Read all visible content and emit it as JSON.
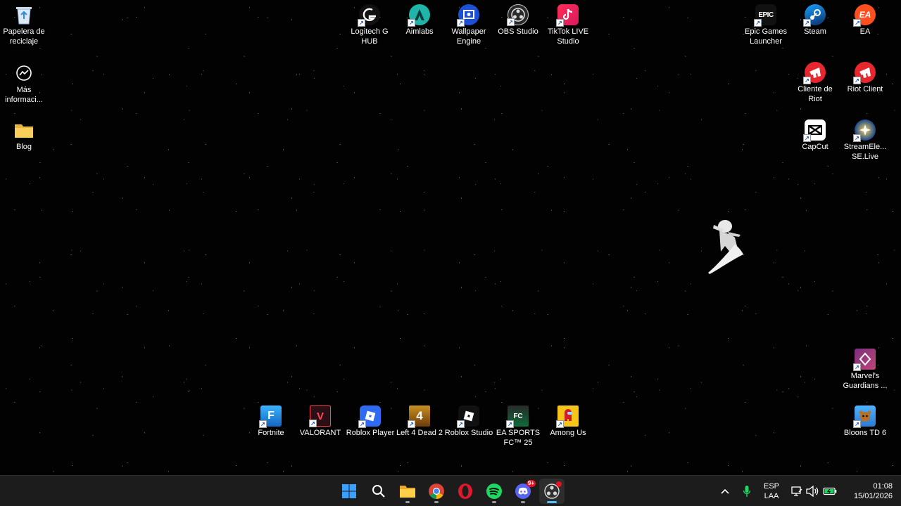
{
  "desktop": {
    "left_icons": [
      {
        "label": "Papelera de reciclaje",
        "icon": "recycle-bin-icon"
      },
      {
        "label": "Más informaci...",
        "icon": "info-icon"
      },
      {
        "label": "Blog",
        "icon": "folder-icon"
      }
    ],
    "top_icons": [
      {
        "label": "Logitech G HUB",
        "icon": "logitech-icon"
      },
      {
        "label": "Aimlabs",
        "icon": "aimlabs-icon"
      },
      {
        "label": "Wallpaper Engine",
        "icon": "wallpaper-engine-icon"
      },
      {
        "label": "OBS Studio",
        "icon": "obs-icon"
      },
      {
        "label": "TikTok LIVE Studio",
        "icon": "tiktok-icon"
      }
    ],
    "right_icons": [
      {
        "label": "Epic Games Launcher",
        "icon": "epic-games-icon",
        "badge": "EPIC"
      },
      {
        "label": "Steam",
        "icon": "steam-icon"
      },
      {
        "label": "EA",
        "icon": "ea-icon",
        "badge": "EA"
      },
      {
        "label": "Cliente de Riot",
        "icon": "riot-icon"
      },
      {
        "label": "Riot Client",
        "icon": "riot-icon"
      },
      {
        "label": "CapCut",
        "icon": "capcut-icon"
      },
      {
        "label": "StreamEle... SE.Live",
        "icon": "streamelements-icon"
      },
      {
        "label": "Marvel's Guardians ...",
        "icon": "guardians-icon"
      },
      {
        "label": "Bloons TD 6",
        "icon": "bloons-icon"
      }
    ],
    "bottom_icons": [
      {
        "label": "Fortnite",
        "icon": "fortnite-icon",
        "badge": "F"
      },
      {
        "label": "VALORANT",
        "icon": "valorant-icon",
        "badge": "V"
      },
      {
        "label": "Roblox Player",
        "icon": "roblox-icon"
      },
      {
        "label": "Left 4 Dead 2",
        "icon": "left4dead-icon",
        "badge": "4"
      },
      {
        "label": "Roblox Studio",
        "icon": "roblox-studio-icon"
      },
      {
        "label": "EA SPORTS FC™ 25",
        "icon": "easportsfc-icon",
        "badge": "FC"
      },
      {
        "label": "Among Us",
        "icon": "among-us-icon"
      }
    ]
  },
  "taskbar": {
    "apps": [
      {
        "name": "start",
        "icon": "windows-start-icon"
      },
      {
        "name": "search",
        "icon": "search-icon"
      },
      {
        "name": "file-explorer",
        "icon": "folder-icon"
      },
      {
        "name": "chrome",
        "icon": "chrome-icon"
      },
      {
        "name": "opera",
        "icon": "opera-icon"
      },
      {
        "name": "spotify",
        "icon": "spotify-icon"
      },
      {
        "name": "discord",
        "icon": "discord-icon",
        "badge": "9+"
      },
      {
        "name": "obs",
        "icon": "obs-icon"
      }
    ],
    "tray": {
      "language_line1": "ESP",
      "language_line2": "LAA",
      "time": "01:08",
      "date": "15/01/2026"
    }
  },
  "colors": {
    "taskbar_bg": "#1c1c1c",
    "active_indicator": "#4cc2ff"
  }
}
